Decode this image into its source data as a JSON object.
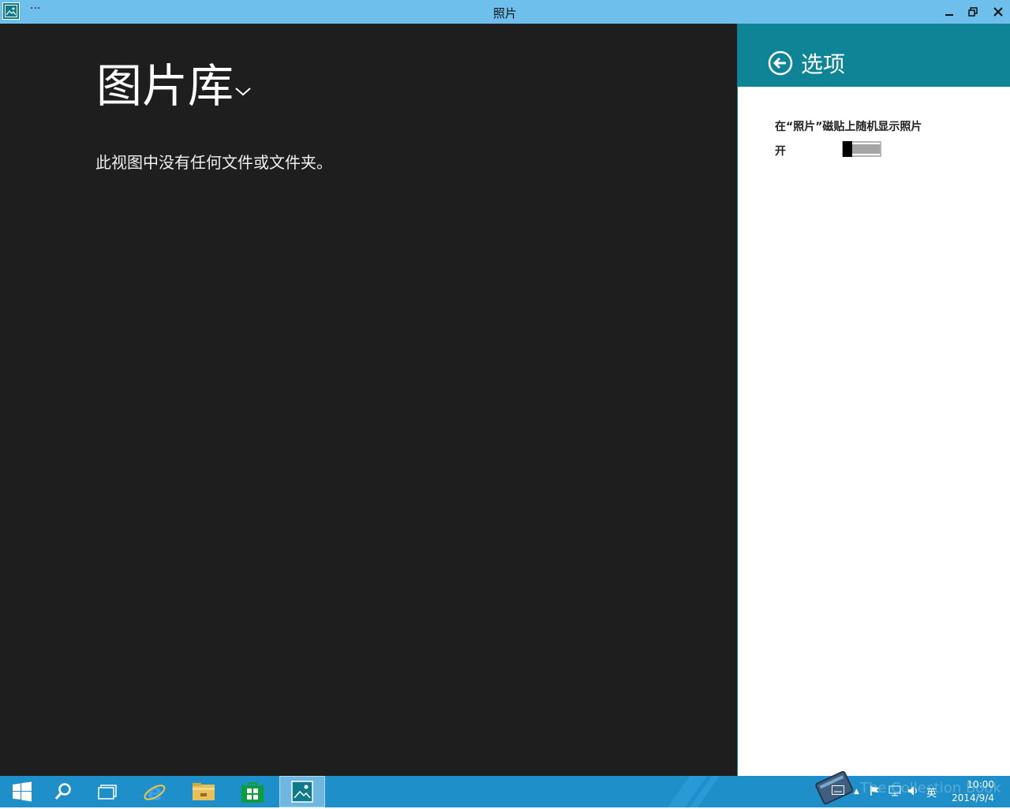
{
  "window": {
    "title": "照片",
    "menu_dots": "···",
    "minimize_glyph": "▁",
    "restore_glyph": "❐",
    "close_glyph": "✕"
  },
  "main": {
    "library_title": "图片库",
    "empty_message": "此视图中没有任何文件或文件夹。"
  },
  "options_panel": {
    "title": "选项",
    "setting_label": "在“照片”磁贴上随机显示照片",
    "toggle_state_label": "开",
    "toggle_on": true
  },
  "taskbar": {
    "apps": [
      "start",
      "search",
      "task-view",
      "internet-explorer",
      "file-explorer",
      "store",
      "photos"
    ],
    "active_app": "photos",
    "tray": {
      "up_arrow": "▲",
      "input_method": "英",
      "time": "10:00",
      "date": "2014/9/4"
    },
    "watermark": "The Collection Book"
  },
  "colors": {
    "titlebar": "#6fbfed",
    "main_bg": "#1e1e1e",
    "panel_header": "#0f8496",
    "taskbar": "#1f8fc9"
  }
}
